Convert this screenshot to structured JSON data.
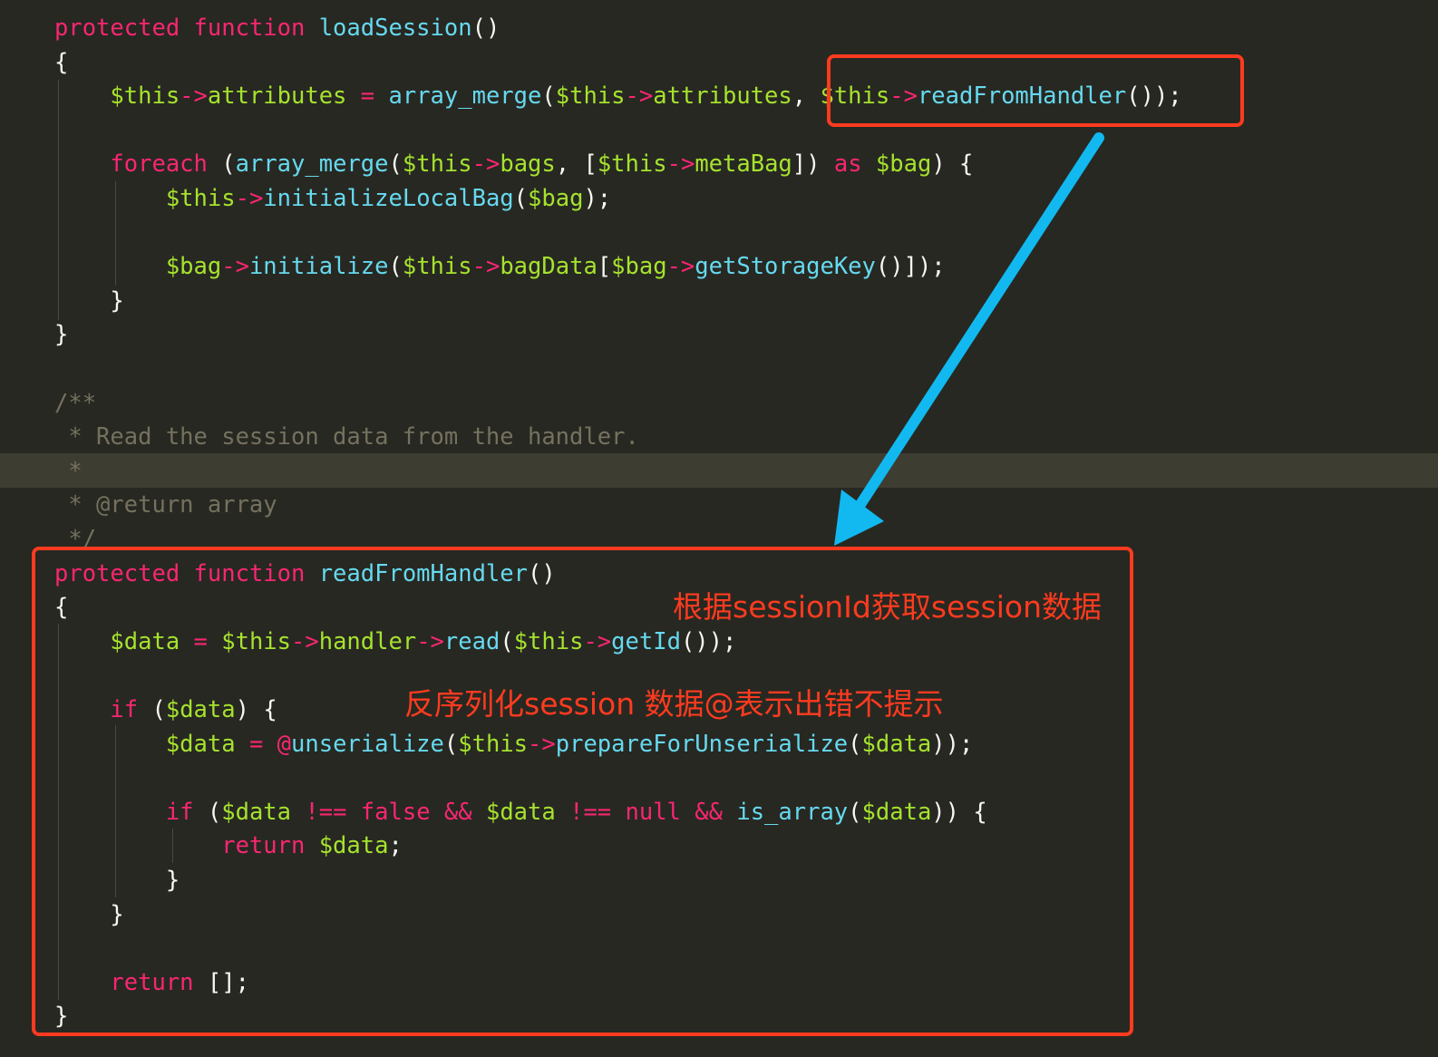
{
  "colors": {
    "background": "#272822",
    "keyword": "#f92672",
    "variable": "#a6e22e",
    "function": "#66d9ef",
    "comment": "#75715e",
    "annotation_box": "#ff3b1f",
    "arrow": "#12b8f0"
  },
  "code": [
    [
      {
        "t": "protected ",
        "c": "kw"
      },
      {
        "t": "function ",
        "c": "kw"
      },
      {
        "t": "loadSession",
        "c": "fn"
      },
      {
        "t": "()",
        "c": "pun"
      }
    ],
    [
      {
        "t": "{",
        "c": "pun"
      }
    ],
    [
      {
        "t": "    $this",
        "c": "var"
      },
      {
        "t": "->",
        "c": "kw"
      },
      {
        "t": "attributes",
        "c": "var"
      },
      {
        "t": " = ",
        "c": "kw"
      },
      {
        "t": "array_merge",
        "c": "fn"
      },
      {
        "t": "(",
        "c": "pun"
      },
      {
        "t": "$this",
        "c": "var"
      },
      {
        "t": "->",
        "c": "kw"
      },
      {
        "t": "attributes",
        "c": "var"
      },
      {
        "t": ", ",
        "c": "pun"
      },
      {
        "t": "$this",
        "c": "var"
      },
      {
        "t": "->",
        "c": "kw"
      },
      {
        "t": "readFromHandler",
        "c": "fn"
      },
      {
        "t": "());",
        "c": "pun"
      }
    ],
    [],
    [
      {
        "t": "    foreach",
        "c": "kw"
      },
      {
        "t": " (",
        "c": "pun"
      },
      {
        "t": "array_merge",
        "c": "fn"
      },
      {
        "t": "(",
        "c": "pun"
      },
      {
        "t": "$this",
        "c": "var"
      },
      {
        "t": "->",
        "c": "kw"
      },
      {
        "t": "bags",
        "c": "var"
      },
      {
        "t": ", [",
        "c": "pun"
      },
      {
        "t": "$this",
        "c": "var"
      },
      {
        "t": "->",
        "c": "kw"
      },
      {
        "t": "metaBag",
        "c": "var"
      },
      {
        "t": "]) ",
        "c": "pun"
      },
      {
        "t": "as",
        "c": "kw"
      },
      {
        "t": " $bag",
        "c": "var"
      },
      {
        "t": ") {",
        "c": "pun"
      }
    ],
    [
      {
        "t": "        $this",
        "c": "var"
      },
      {
        "t": "->",
        "c": "kw"
      },
      {
        "t": "initializeLocalBag",
        "c": "fn"
      },
      {
        "t": "(",
        "c": "pun"
      },
      {
        "t": "$bag",
        "c": "var"
      },
      {
        "t": ");",
        "c": "pun"
      }
    ],
    [],
    [
      {
        "t": "        $bag",
        "c": "var"
      },
      {
        "t": "->",
        "c": "kw"
      },
      {
        "t": "initialize",
        "c": "fn"
      },
      {
        "t": "(",
        "c": "pun"
      },
      {
        "t": "$this",
        "c": "var"
      },
      {
        "t": "->",
        "c": "kw"
      },
      {
        "t": "bagData",
        "c": "var"
      },
      {
        "t": "[",
        "c": "pun"
      },
      {
        "t": "$bag",
        "c": "var"
      },
      {
        "t": "->",
        "c": "kw"
      },
      {
        "t": "getStorageKey",
        "c": "fn"
      },
      {
        "t": "()]);",
        "c": "pun"
      }
    ],
    [
      {
        "t": "    }",
        "c": "pun"
      }
    ],
    [
      {
        "t": "}",
        "c": "pun"
      }
    ],
    [],
    [
      {
        "t": "/**",
        "c": "cm"
      }
    ],
    [
      {
        "t": " * Read the session data from the handler.",
        "c": "cm"
      }
    ],
    [
      {
        "t": " *",
        "c": "cm"
      }
    ],
    [
      {
        "t": " * @return array",
        "c": "cm"
      }
    ],
    [
      {
        "t": " */",
        "c": "cm"
      }
    ],
    [
      {
        "t": "protected ",
        "c": "kw"
      },
      {
        "t": "function ",
        "c": "kw"
      },
      {
        "t": "readFromHandler",
        "c": "fn"
      },
      {
        "t": "()",
        "c": "pun"
      }
    ],
    [
      {
        "t": "{",
        "c": "pun"
      }
    ],
    [
      {
        "t": "    $data",
        "c": "var"
      },
      {
        "t": " = ",
        "c": "kw"
      },
      {
        "t": "$this",
        "c": "var"
      },
      {
        "t": "->",
        "c": "kw"
      },
      {
        "t": "handler",
        "c": "var"
      },
      {
        "t": "->",
        "c": "kw"
      },
      {
        "t": "read",
        "c": "fn"
      },
      {
        "t": "(",
        "c": "pun"
      },
      {
        "t": "$this",
        "c": "var"
      },
      {
        "t": "->",
        "c": "kw"
      },
      {
        "t": "getId",
        "c": "fn"
      },
      {
        "t": "());",
        "c": "pun"
      }
    ],
    [],
    [
      {
        "t": "    if",
        "c": "kw"
      },
      {
        "t": " (",
        "c": "pun"
      },
      {
        "t": "$data",
        "c": "var"
      },
      {
        "t": ") {",
        "c": "pun"
      }
    ],
    [
      {
        "t": "        $data",
        "c": "var"
      },
      {
        "t": " = ",
        "c": "kw"
      },
      {
        "t": "@",
        "c": "kw"
      },
      {
        "t": "unserialize",
        "c": "fn"
      },
      {
        "t": "(",
        "c": "pun"
      },
      {
        "t": "$this",
        "c": "var"
      },
      {
        "t": "->",
        "c": "kw"
      },
      {
        "t": "prepareForUnserialize",
        "c": "fn"
      },
      {
        "t": "(",
        "c": "pun"
      },
      {
        "t": "$data",
        "c": "var"
      },
      {
        "t": "));",
        "c": "pun"
      }
    ],
    [],
    [
      {
        "t": "        if",
        "c": "kw"
      },
      {
        "t": " (",
        "c": "pun"
      },
      {
        "t": "$data",
        "c": "var"
      },
      {
        "t": " !== ",
        "c": "kw"
      },
      {
        "t": "false",
        "c": "kw"
      },
      {
        "t": " && ",
        "c": "kw"
      },
      {
        "t": "$data",
        "c": "var"
      },
      {
        "t": " !== ",
        "c": "kw"
      },
      {
        "t": "null",
        "c": "kw"
      },
      {
        "t": " && ",
        "c": "kw"
      },
      {
        "t": "is_array",
        "c": "fn"
      },
      {
        "t": "(",
        "c": "pun"
      },
      {
        "t": "$data",
        "c": "var"
      },
      {
        "t": ")) {",
        "c": "pun"
      }
    ],
    [
      {
        "t": "            return",
        "c": "kw"
      },
      {
        "t": " $data",
        "c": "var"
      },
      {
        "t": ";",
        "c": "pun"
      }
    ],
    [
      {
        "t": "        }",
        "c": "pun"
      }
    ],
    [
      {
        "t": "    }",
        "c": "pun"
      }
    ],
    [],
    [
      {
        "t": "    return",
        "c": "kw"
      },
      {
        "t": " [];",
        "c": "pun"
      }
    ],
    [
      {
        "t": "}",
        "c": "pun"
      }
    ]
  ],
  "annotations": {
    "note_session_id": "根据sessionId获取session数据",
    "note_unserialize": "反序列化session 数据@表示出错不提示"
  }
}
